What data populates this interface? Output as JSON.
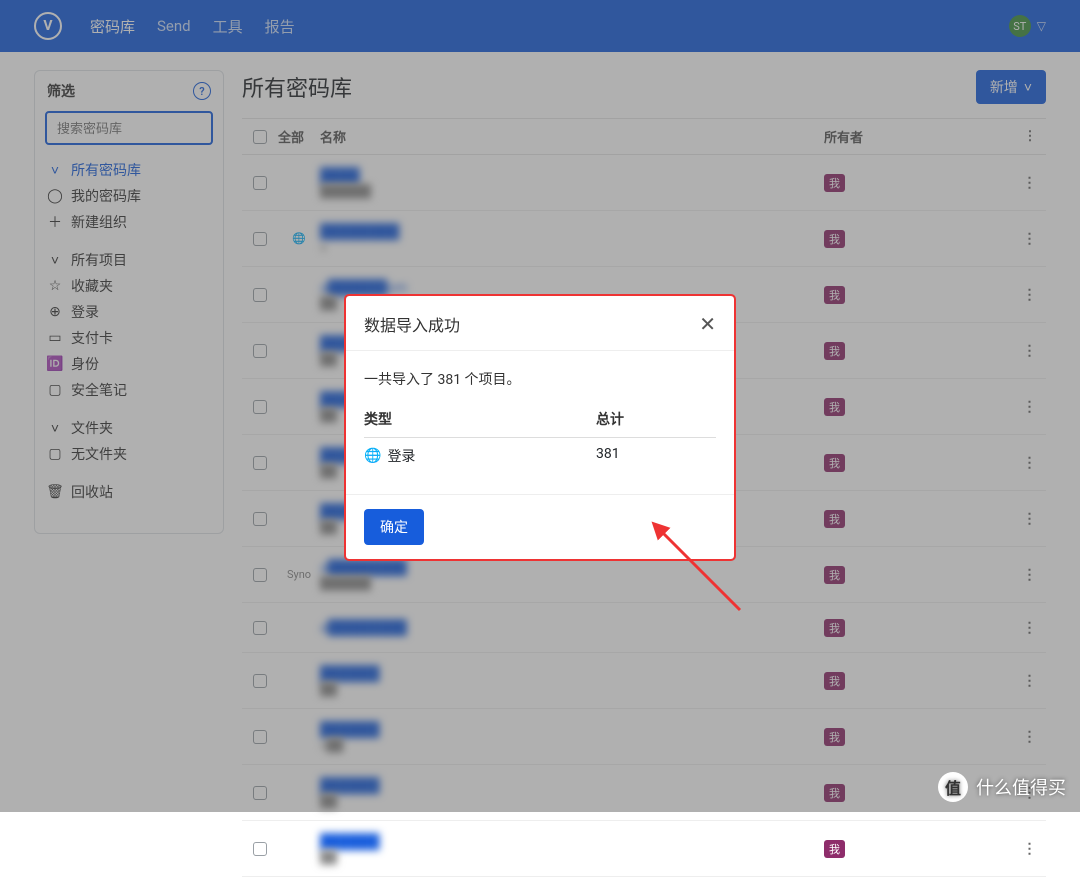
{
  "nav": {
    "items": [
      "密码库",
      "Send",
      "工具",
      "报告"
    ],
    "avatar": "ST"
  },
  "sidebar": {
    "title": "筛选",
    "search_placeholder": "搜索密码库",
    "groups": [
      {
        "items": [
          {
            "icon": "˅",
            "label": "所有密码库",
            "active": true
          },
          {
            "icon": "◯",
            "label": "我的密码库"
          },
          {
            "icon": "＋",
            "label": "新建组织"
          }
        ]
      },
      {
        "items": [
          {
            "icon": "˅",
            "label": "所有项目"
          },
          {
            "icon": "☆",
            "label": "收藏夹"
          },
          {
            "icon": "⊕",
            "label": "登录"
          },
          {
            "icon": "▭",
            "label": "支付卡"
          },
          {
            "icon": "🆔",
            "label": "身份"
          },
          {
            "icon": "▢",
            "label": "安全笔记"
          }
        ]
      },
      {
        "items": [
          {
            "icon": "˅",
            "label": "文件夹"
          },
          {
            "icon": "▢",
            "label": "无文件夹"
          }
        ]
      },
      {
        "items": [
          {
            "icon": "🗑",
            "label": "回收站"
          }
        ]
      }
    ]
  },
  "main": {
    "title": "所有密码库",
    "new_label": "新增",
    "columns": {
      "all": "全部",
      "name": "名称",
      "owner": "所有者"
    },
    "owner_badge": "我",
    "rows": [
      {
        "icon": "",
        "name": "████",
        "sub": "██████"
      },
      {
        "icon": "🌐",
        "name": "████████",
        "sub": "a"
      },
      {
        "icon": "",
        "name": "a██████om",
        "sub": "██"
      },
      {
        "icon": "",
        "name": "████",
        "sub": "██"
      },
      {
        "icon": "",
        "name": "████",
        "sub": "██"
      },
      {
        "icon": "",
        "name": "████",
        "sub": "██"
      },
      {
        "icon": "",
        "name": "████",
        "sub": "██"
      },
      {
        "icon": "Syno",
        "name": "a████████",
        "sub": "██████"
      },
      {
        "icon": "",
        "name": "a████████",
        "sub": ""
      },
      {
        "icon": "",
        "name": "██████",
        "sub": "██"
      },
      {
        "icon": "",
        "name": "██████",
        "sub": "c██"
      },
      {
        "icon": "",
        "name": "██████",
        "sub": "██"
      },
      {
        "icon": "",
        "name": "██████",
        "sub": "██"
      }
    ]
  },
  "modal": {
    "title": "数据导入成功",
    "message": "一共导入了 381 个项目。",
    "col_type": "类型",
    "col_total": "总计",
    "row_type_label": "登录",
    "row_total": "381",
    "ok": "确定"
  },
  "watermark": "什么值得买",
  "watermark_badge": "值"
}
